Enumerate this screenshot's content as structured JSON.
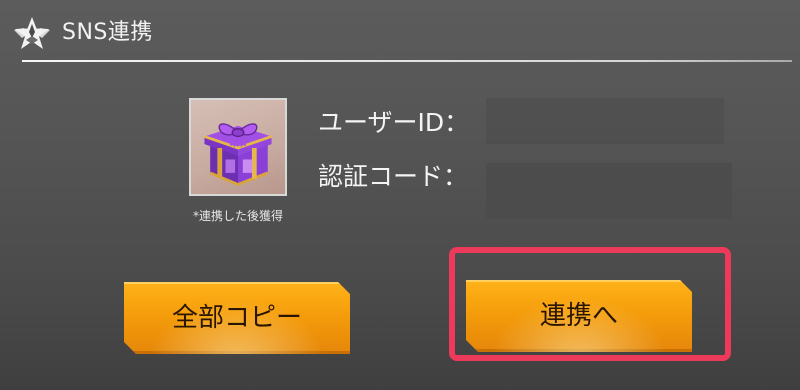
{
  "window": {
    "title": "SNS連携",
    "logo_icon": "star-emblem-icon"
  },
  "reward": {
    "icon": "gift-box-icon",
    "note": "*連携した後獲得"
  },
  "info": {
    "user_id_label": "ユーザーID：",
    "user_id_value": "",
    "auth_code_label": "認証コード：",
    "auth_code_value": ""
  },
  "buttons": {
    "copy_all_label": "全部コピー",
    "link_label": "連携へ"
  },
  "colors": {
    "button": "#f59d0b",
    "highlight": "#ee3a5a",
    "panel": "#555555"
  }
}
